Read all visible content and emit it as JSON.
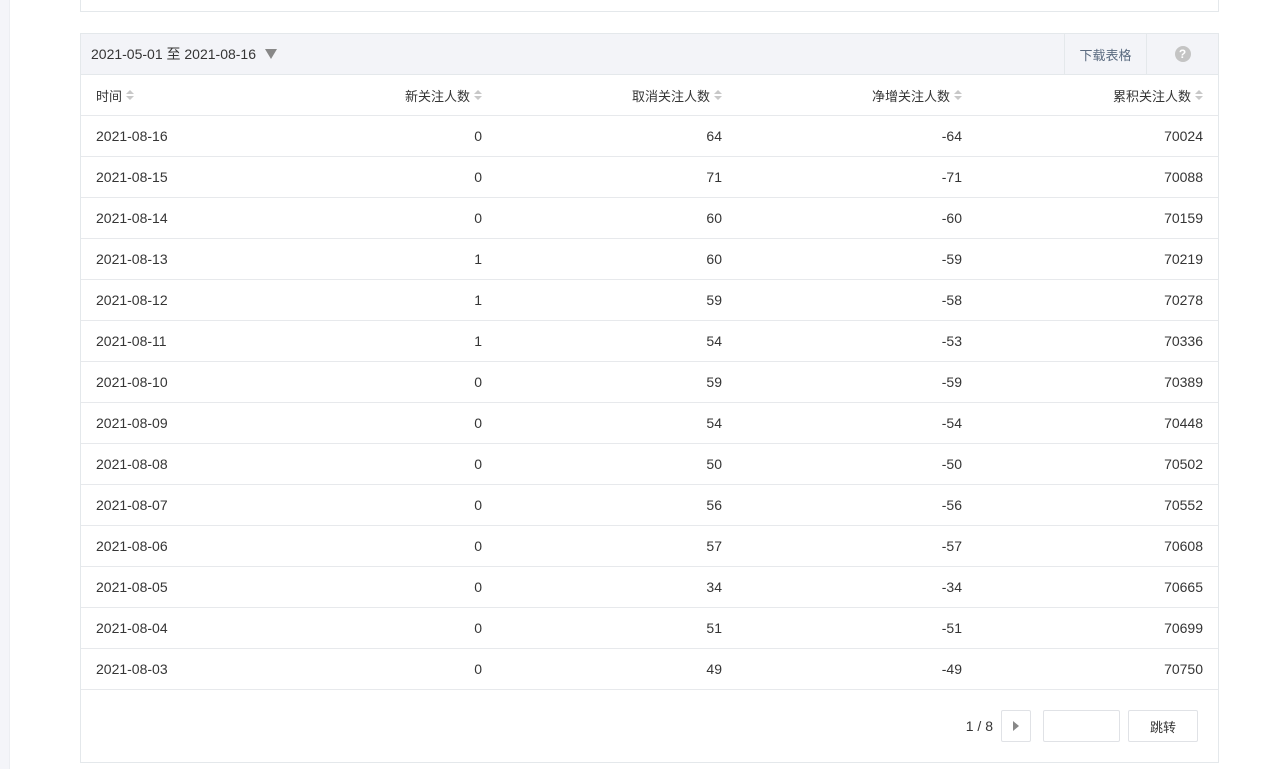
{
  "panel": {
    "date_range": "2021-05-01 至 2021-08-16",
    "download_label": "下载表格",
    "help_label": "?"
  },
  "table": {
    "headers": [
      "时间",
      "新关注人数",
      "取消关注人数",
      "净增关注人数",
      "累积关注人数"
    ],
    "rows": [
      [
        "2021-08-16",
        "0",
        "64",
        "-64",
        "70024"
      ],
      [
        "2021-08-15",
        "0",
        "71",
        "-71",
        "70088"
      ],
      [
        "2021-08-14",
        "0",
        "60",
        "-60",
        "70159"
      ],
      [
        "2021-08-13",
        "1",
        "60",
        "-59",
        "70219"
      ],
      [
        "2021-08-12",
        "1",
        "59",
        "-58",
        "70278"
      ],
      [
        "2021-08-11",
        "1",
        "54",
        "-53",
        "70336"
      ],
      [
        "2021-08-10",
        "0",
        "59",
        "-59",
        "70389"
      ],
      [
        "2021-08-09",
        "0",
        "54",
        "-54",
        "70448"
      ],
      [
        "2021-08-08",
        "0",
        "50",
        "-50",
        "70502"
      ],
      [
        "2021-08-07",
        "0",
        "56",
        "-56",
        "70552"
      ],
      [
        "2021-08-06",
        "0",
        "57",
        "-57",
        "70608"
      ],
      [
        "2021-08-05",
        "0",
        "34",
        "-34",
        "70665"
      ],
      [
        "2021-08-04",
        "0",
        "51",
        "-51",
        "70699"
      ],
      [
        "2021-08-03",
        "0",
        "49",
        "-49",
        "70750"
      ]
    ]
  },
  "pagination": {
    "page_info": "1 / 8",
    "jump_value": "",
    "jump_label": "跳转"
  }
}
